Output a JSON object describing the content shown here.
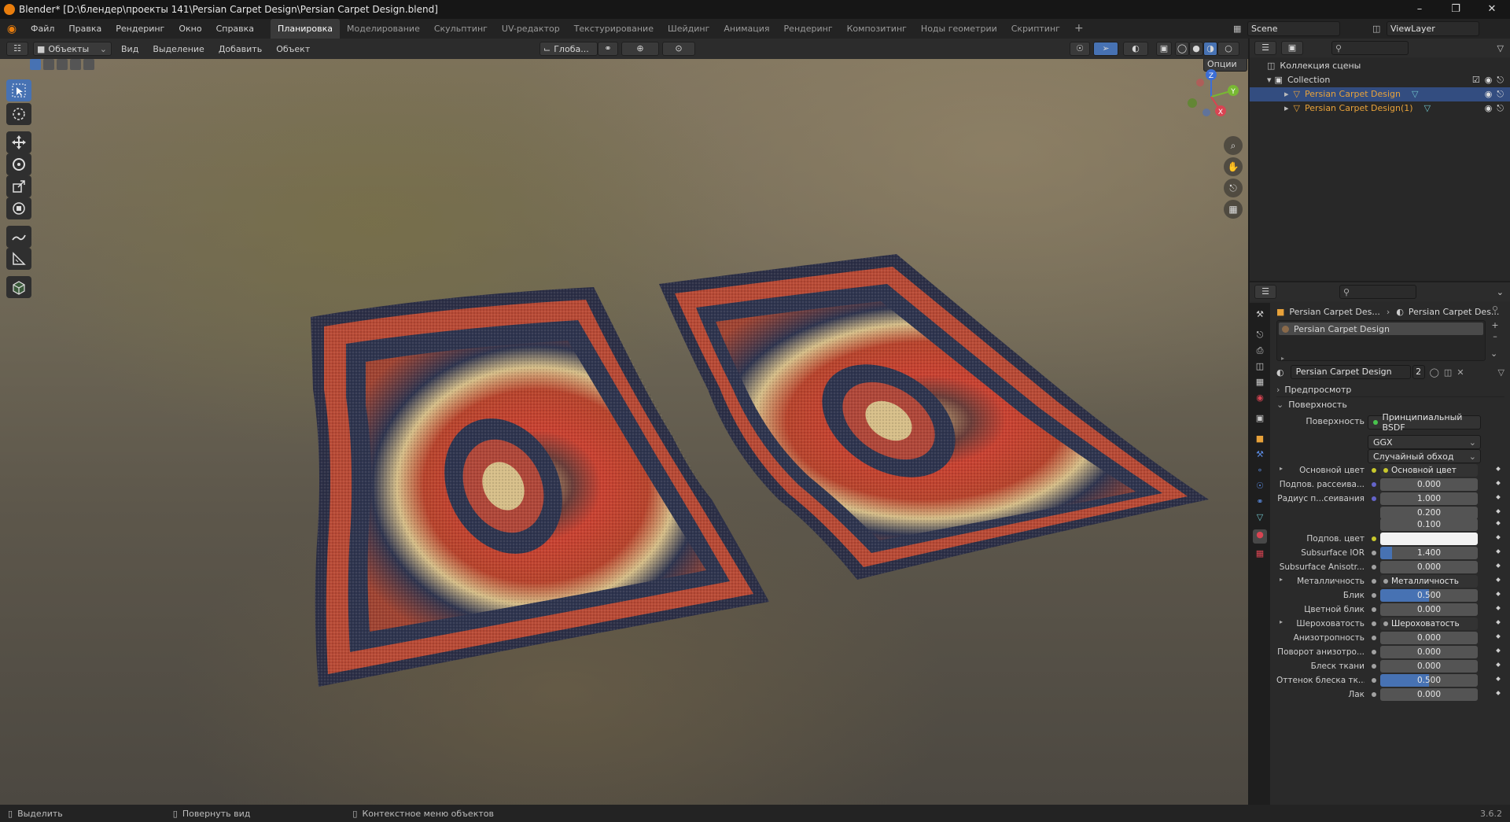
{
  "titlebar": {
    "title": "Blender* [D:\\блендер\\проекты 141\\Persian Carpet Design\\Persian Carpet Design.blend]"
  },
  "menu": [
    "Файл",
    "Правка",
    "Рендеринг",
    "Окно",
    "Справка"
  ],
  "workspaces": [
    "Планировка",
    "Моделирование",
    "Скульптинг",
    "UV-редактор",
    "Текстурирование",
    "Шейдинг",
    "Анимация",
    "Рендеринг",
    "Композитинг",
    "Ноды геометрии",
    "Скриптинг"
  ],
  "active_workspace": "Планировка",
  "scene": {
    "name": "Scene",
    "view_layer": "ViewLayer"
  },
  "viewport_header": {
    "mode": "Объекты",
    "menus": [
      "Вид",
      "Выделение",
      "Добавить",
      "Объект"
    ],
    "orientation": "Глоба...",
    "options_label": "Опции"
  },
  "gizmo": {
    "x": "X",
    "y": "Y",
    "z": "Z"
  },
  "outliner": {
    "root": "Коллекция сцены",
    "collection": "Collection",
    "objects": [
      "Persian Carpet Design",
      "Persian Carpet Design(1)"
    ]
  },
  "properties": {
    "breadcrumb": [
      "Persian Carpet Des...",
      "Persian Carpet Des..."
    ],
    "material_slot": "Persian Carpet Design",
    "material_name": "Persian Carpet Design",
    "users": "2",
    "panels": {
      "preview": "Предпросмотр",
      "surface": "Поверхность"
    },
    "surface_shader_label": "Поверхность",
    "surface_shader": "Принципиальный BSDF",
    "distribution": "GGX",
    "subsurface_method": "Случайный обход",
    "rows": [
      {
        "label": "Основной цвет",
        "value": "Основной цвет",
        "type": "link",
        "dot": "#c8c82c"
      },
      {
        "label": "Подпов. рассеива...",
        "value": "0.000",
        "type": "num",
        "dot": "#6464c8"
      },
      {
        "label": "Радиус п...сеивания",
        "value": "1.000",
        "type": "num",
        "dot": "#6464c8"
      },
      {
        "label": "",
        "value": "0.200",
        "type": "num",
        "dot": ""
      },
      {
        "label": "",
        "value": "0.100",
        "type": "num",
        "dot": ""
      },
      {
        "label": "Подпов. цвет",
        "value": "",
        "type": "color",
        "dot": "#c8c82c"
      },
      {
        "label": "Subsurface IOR",
        "value": "1.400",
        "type": "num",
        "dot": "#a1a1a1"
      },
      {
        "label": "Subsurface Anisotr...",
        "value": "0.000",
        "type": "num",
        "dot": "#a1a1a1"
      },
      {
        "label": "Металличность",
        "value": "Металличность",
        "type": "link",
        "dot": "#a1a1a1"
      },
      {
        "label": "Блик",
        "value": "0.500",
        "type": "slider",
        "dot": "#a1a1a1"
      },
      {
        "label": "Цветной блик",
        "value": "0.000",
        "type": "num",
        "dot": "#a1a1a1"
      },
      {
        "label": "Шероховатость",
        "value": "Шероховатость",
        "type": "link",
        "dot": "#a1a1a1"
      },
      {
        "label": "Анизотропность",
        "value": "0.000",
        "type": "num",
        "dot": "#a1a1a1"
      },
      {
        "label": "Поворот анизотро...",
        "value": "0.000",
        "type": "num",
        "dot": "#a1a1a1"
      },
      {
        "label": "Блеск ткани",
        "value": "0.000",
        "type": "num",
        "dot": "#a1a1a1"
      },
      {
        "label": "Оттенок блеска тк...",
        "value": "0.500",
        "type": "slider",
        "dot": "#a1a1a1"
      },
      {
        "label": "Лак",
        "value": "0.000",
        "type": "num",
        "dot": "#a1a1a1"
      }
    ]
  },
  "statusbar": {
    "select": "Выделить",
    "rotate": "Повернуть вид",
    "context": "Контекстное меню объектов",
    "version": "3.6.2"
  },
  "colors": {
    "accent": "#4772b3",
    "selection": "#334d80",
    "object_orange": "#e8a23a",
    "blender_orange": "#e87d0d"
  }
}
